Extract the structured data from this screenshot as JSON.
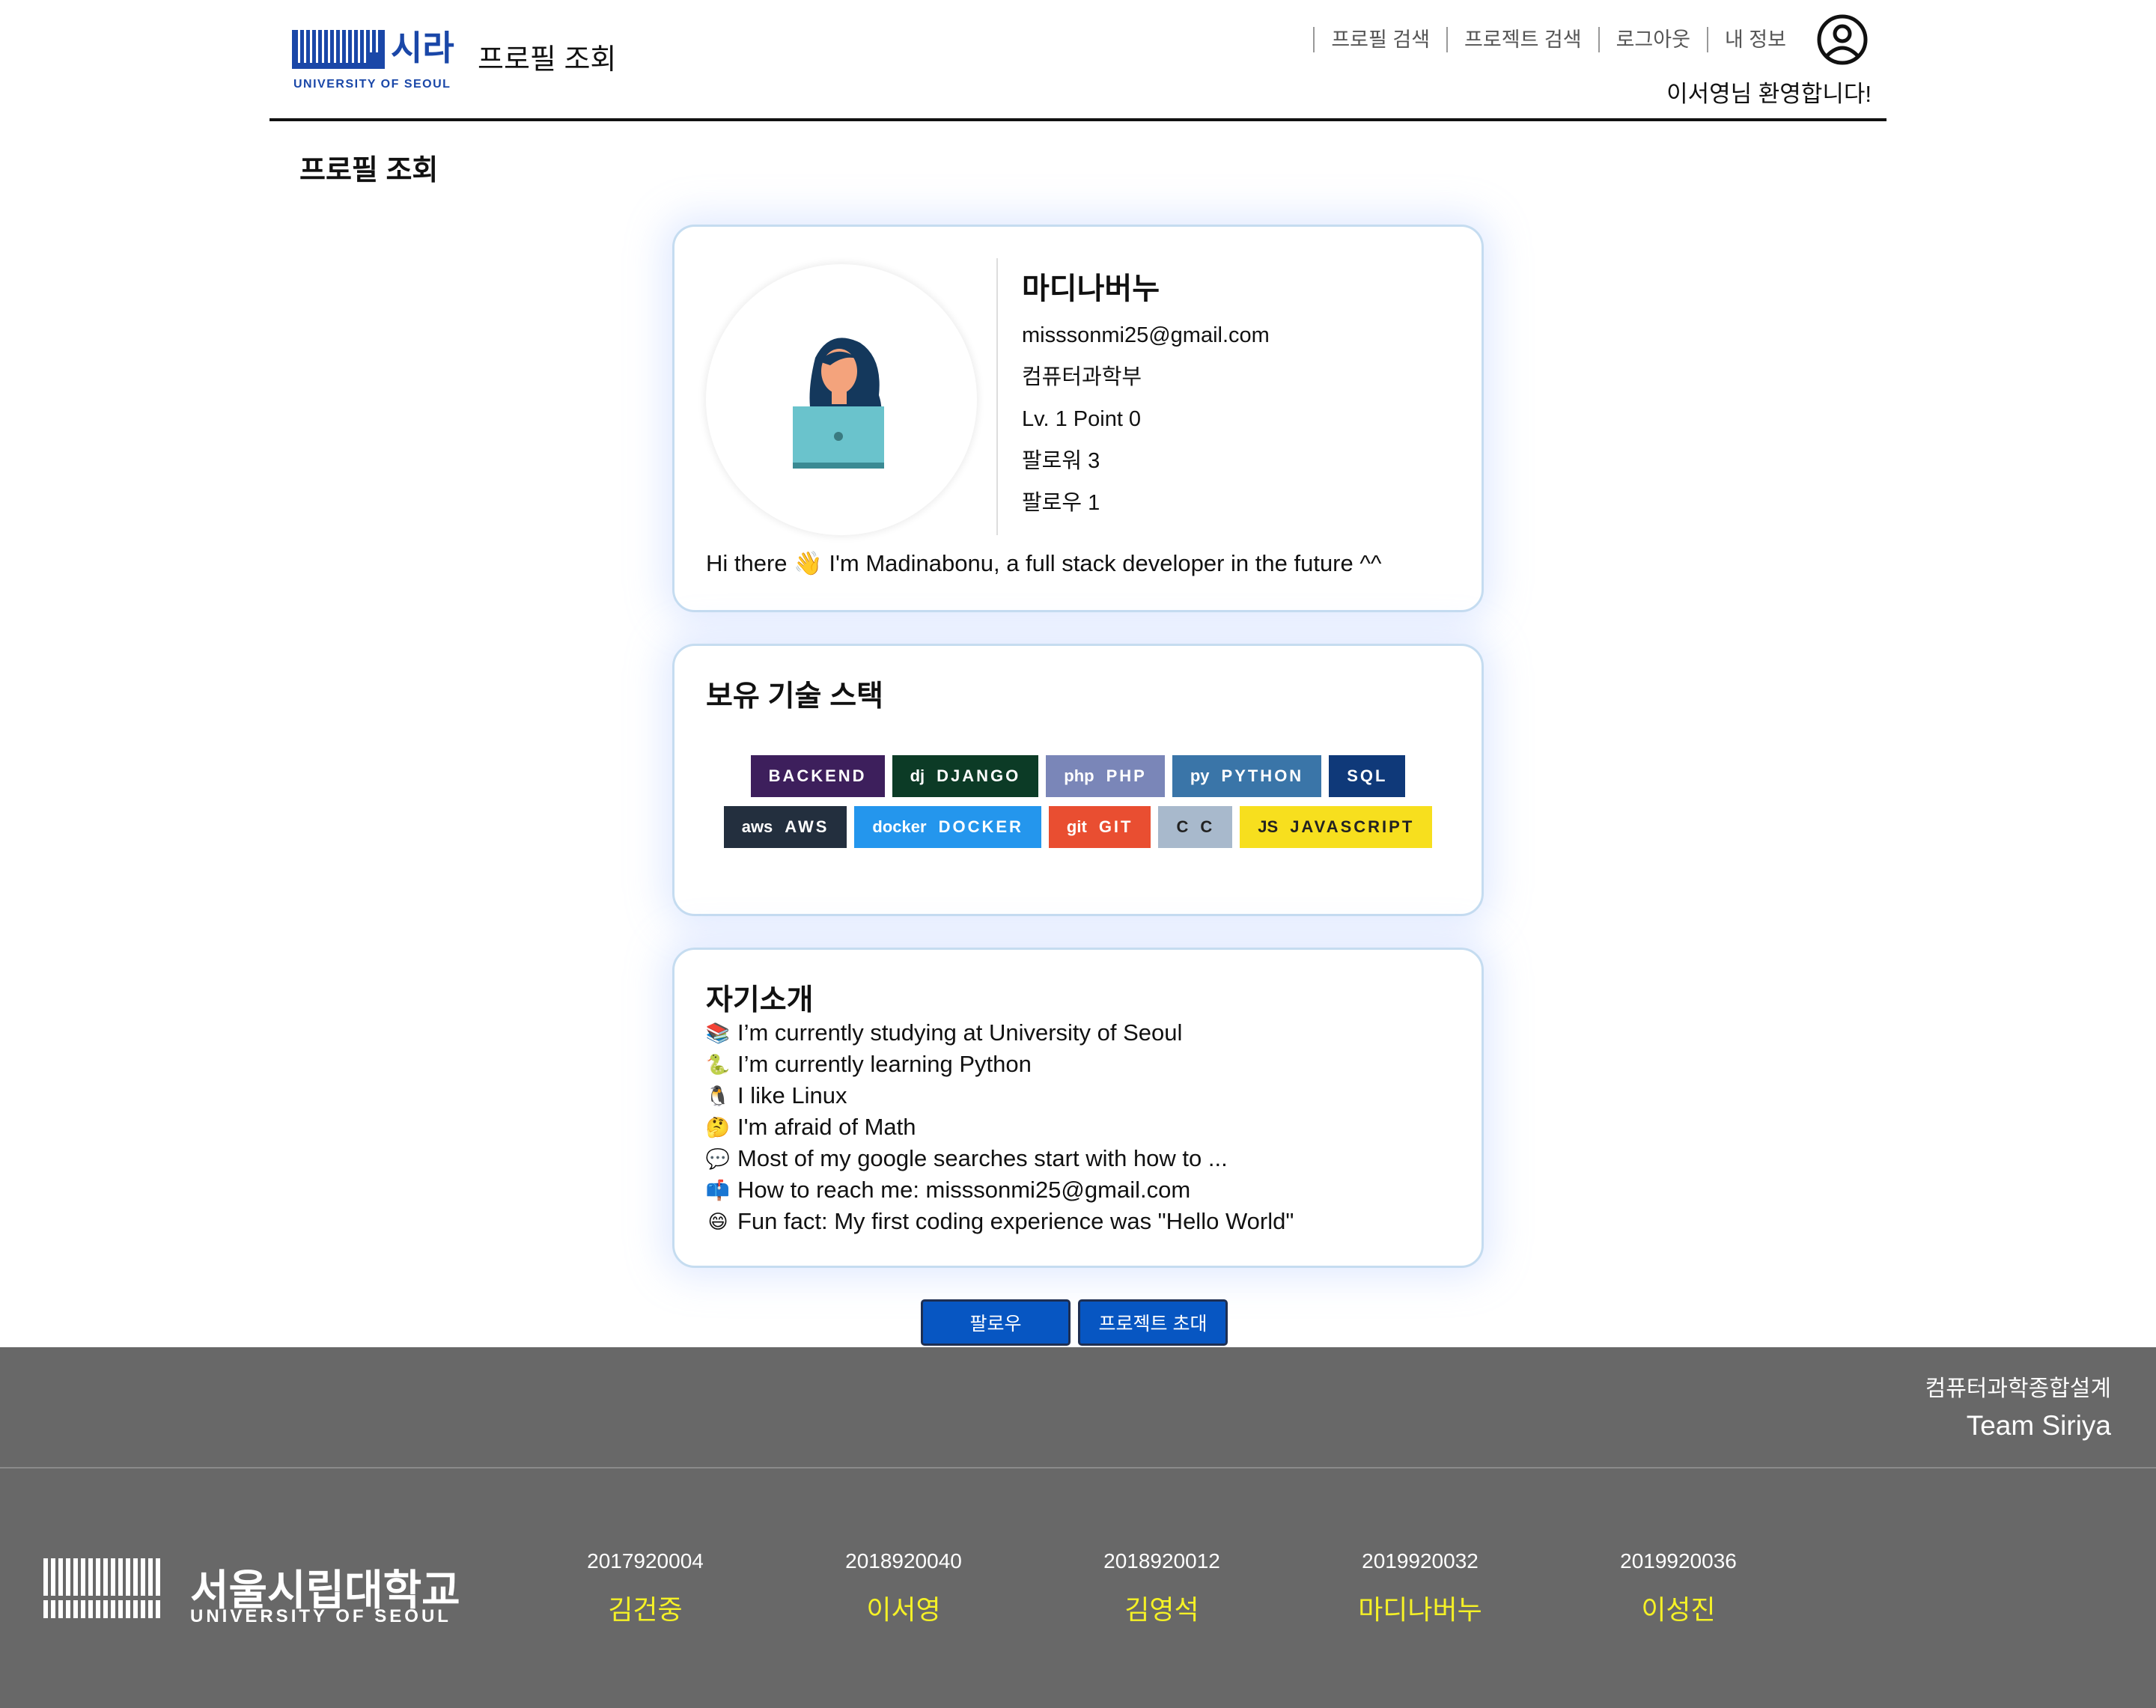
{
  "header": {
    "logo_sira": "시라",
    "logo_univ": "UNIVERSITY OF SEOUL",
    "title": "프로필 조회",
    "nav": [
      "프로필 검색",
      "프로젝트 검색",
      "로그아웃",
      "내 정보"
    ],
    "welcome": "이서영님 환영합니다!"
  },
  "page_title": "프로필 조회",
  "profile": {
    "name": "마디나버누",
    "email": "misssonmi25@gmail.com",
    "department": "컴퓨터과학부",
    "level": "Lv. 1 Point 0",
    "followers": "팔로워 3",
    "following": "팔로우 1",
    "bio": "Hi there 👋 I'm Madinabonu, a full stack developer in the future ^^"
  },
  "stack": {
    "heading": "보유 기술 스택",
    "row1": [
      {
        "label": "BACKEND",
        "icon": "",
        "color": "#3d1f5c"
      },
      {
        "label": "DJANGO",
        "icon": "dj",
        "color": "#0c3b26"
      },
      {
        "label": "PHP",
        "icon": "php",
        "color": "#7a86b8"
      },
      {
        "label": "PYTHON",
        "icon": "py",
        "color": "#3a75a8"
      },
      {
        "label": "SQL",
        "icon": "",
        "color": "#0f3979"
      }
    ],
    "row2": [
      {
        "label": "AWS",
        "icon": "aws",
        "color": "#232f3e"
      },
      {
        "label": "DOCKER",
        "icon": "docker",
        "color": "#2496ed"
      },
      {
        "label": "GIT",
        "icon": "git",
        "color": "#e94e31"
      },
      {
        "label": "C",
        "icon": "C",
        "color": "#a8b9cc"
      },
      {
        "label": "JAVASCRIPT",
        "icon": "JS",
        "color": "#f7df1e"
      }
    ]
  },
  "intro": {
    "heading": "자기소개",
    "items": [
      {
        "emoji": "📚",
        "text": "I’m currently studying at University of Seoul"
      },
      {
        "emoji": "🐍",
        "text": "I’m currently learning Python"
      },
      {
        "emoji": "🐧",
        "text": "I like Linux"
      },
      {
        "emoji": "🤔",
        "text": "I'm afraid of Math"
      },
      {
        "emoji": "💬",
        "text": "Most of my google searches start with how to ..."
      },
      {
        "emoji": "📫",
        "text": "How to reach me: misssonmi25@gmail.com"
      },
      {
        "emoji": "😄",
        "text": "Fun fact: My first coding experience was \"Hello World\""
      }
    ]
  },
  "buttons": {
    "follow": "팔로우",
    "invite": "프로젝트 초대"
  },
  "footer": {
    "course": "컴퓨터과학종합설계",
    "team": "Team Siriya",
    "univ_kr": "서울시립대학교",
    "univ_en": "UNIVERSITY OF SEOUL",
    "members": [
      {
        "id": "2017920004",
        "name": "김건중"
      },
      {
        "id": "2018920040",
        "name": "이서영"
      },
      {
        "id": "2018920012",
        "name": "김영석"
      },
      {
        "id": "2019920032",
        "name": "마디나버누"
      },
      {
        "id": "2019920036",
        "name": "이성진"
      }
    ]
  }
}
